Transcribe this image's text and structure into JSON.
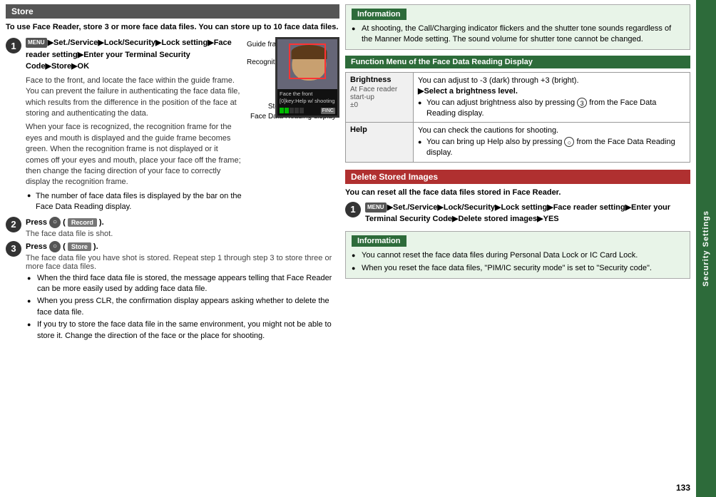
{
  "page": {
    "number": "133",
    "sidebar_label": "Security Settings"
  },
  "left": {
    "section_title": "Store",
    "intro": "To use Face Reader, store 3 or more face data files. You can store up to 10 face data files.",
    "step1": {
      "number": "1",
      "path": "▶Set./Service▶Lock/Security▶Lock setting▶Face reader setting▶Enter your Terminal Security Code▶Store▶OK",
      "desc": "Face to the front, and locate the face within the guide frame. You can prevent the failure in authenticating the face data file, which results from the difference in the position of the face at storing and authenticating the data.",
      "desc2": "When your face is recognized, the recognition frame for the eyes and mouth is displayed and the guide frame becomes green. When the recognition frame is not displayed or it comes off your eyes and mouth, place your face off the frame; then change the facing direction of your face to correctly display the recognition frame.",
      "bullet1": "The number of face data files is displayed by the bar on the Face Data Reading display.",
      "diagram": {
        "guide_frame_label": "Guide frame",
        "recognition_frame_label": "Recognition frame",
        "face_text": "Face the front\n[0]key:Help w/ shooting",
        "stored_bar_label": "Stored number bar",
        "caption": "Face Data Reading display"
      }
    },
    "step2": {
      "number": "2",
      "text": "Press",
      "btn": "○",
      "btn_label": "Record",
      "desc": "The face data file is shot."
    },
    "step3": {
      "number": "3",
      "text": "Press",
      "btn": "○",
      "btn_label": "Store",
      "desc": "The face data file you have shot is stored. Repeat step 1 through step 3 to store three or more face data files.",
      "bullet1": "When the third face data file is stored, the message appears telling that Face Reader can be more easily used by adding face data file.",
      "bullet2": "When you press CLR, the confirmation display appears asking whether to delete the face data file.",
      "bullet3": "If you try to store the face data file in the same environment, you might not be able to store it. Change the direction of the face or the place for shooting."
    }
  },
  "right": {
    "info1": {
      "title": "Information",
      "bullets": [
        "At shooting, the Call/Charging indicator flickers and the shutter tone sounds regardless of the Manner Mode setting. The sound volume for shutter tone cannot be changed."
      ]
    },
    "func_menu": {
      "title": "Function Menu of the Face Data Reading Display",
      "rows": [
        {
          "name": "Brightness",
          "sub": "At Face reader start-up\n±0",
          "desc": "You can adjust to -3 (dark) through +3 (bright).\n▶Select a brightness level.\n● You can adjust brightness also by pressing 3 from the Face Data Reading display."
        },
        {
          "name": "Help",
          "sub": "",
          "desc": "You can check the cautions for shooting.\n● You can bring up Help also by pressing ○ from the Face Data Reading display."
        }
      ]
    },
    "delete_section": {
      "title": "Delete Stored Images",
      "intro": "You can reset all the face data files stored in Face Reader.",
      "step1": {
        "number": "1",
        "path": "▶Set./Service▶Lock/Security▶Lock setting▶Face reader setting▶Enter your Terminal Security Code▶Delete stored images▶YES"
      }
    },
    "info2": {
      "title": "Information",
      "bullets": [
        "You cannot reset the face data files during Personal Data Lock or IC Card Lock.",
        "When you reset the face data files, \"PIM/IC security mode\" is set to \"Security code\"."
      ]
    }
  }
}
